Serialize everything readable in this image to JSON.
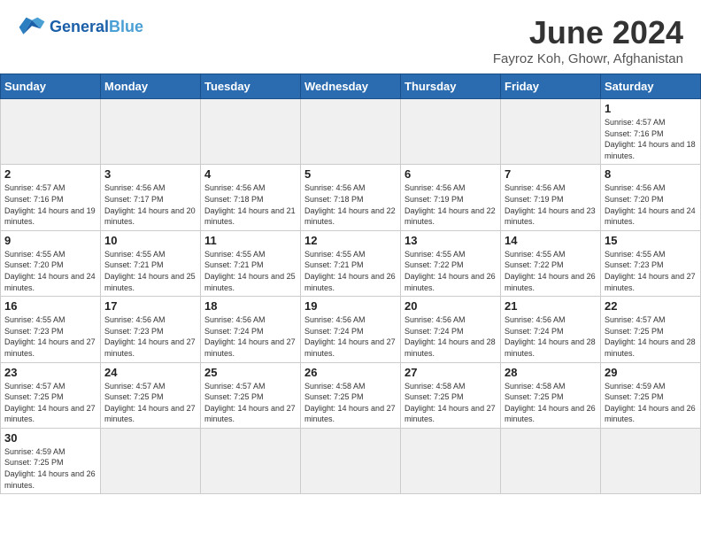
{
  "header": {
    "logo_general": "General",
    "logo_blue": "Blue",
    "title": "June 2024",
    "location": "Fayroz Koh, Ghowr, Afghanistan"
  },
  "weekdays": [
    "Sunday",
    "Monday",
    "Tuesday",
    "Wednesday",
    "Thursday",
    "Friday",
    "Saturday"
  ],
  "days": {
    "d1": {
      "num": "1",
      "sunrise": "4:57 AM",
      "sunset": "7:16 PM",
      "daylight": "14 hours and 18 minutes."
    },
    "d2": {
      "num": "2",
      "sunrise": "4:57 AM",
      "sunset": "7:16 PM",
      "daylight": "14 hours and 19 minutes."
    },
    "d3": {
      "num": "3",
      "sunrise": "4:56 AM",
      "sunset": "7:17 PM",
      "daylight": "14 hours and 20 minutes."
    },
    "d4": {
      "num": "4",
      "sunrise": "4:56 AM",
      "sunset": "7:18 PM",
      "daylight": "14 hours and 21 minutes."
    },
    "d5": {
      "num": "5",
      "sunrise": "4:56 AM",
      "sunset": "7:18 PM",
      "daylight": "14 hours and 22 minutes."
    },
    "d6": {
      "num": "6",
      "sunrise": "4:56 AM",
      "sunset": "7:19 PM",
      "daylight": "14 hours and 22 minutes."
    },
    "d7": {
      "num": "7",
      "sunrise": "4:56 AM",
      "sunset": "7:19 PM",
      "daylight": "14 hours and 23 minutes."
    },
    "d8": {
      "num": "8",
      "sunrise": "4:56 AM",
      "sunset": "7:20 PM",
      "daylight": "14 hours and 24 minutes."
    },
    "d9": {
      "num": "9",
      "sunrise": "4:55 AM",
      "sunset": "7:20 PM",
      "daylight": "14 hours and 24 minutes."
    },
    "d10": {
      "num": "10",
      "sunrise": "4:55 AM",
      "sunset": "7:21 PM",
      "daylight": "14 hours and 25 minutes."
    },
    "d11": {
      "num": "11",
      "sunrise": "4:55 AM",
      "sunset": "7:21 PM",
      "daylight": "14 hours and 25 minutes."
    },
    "d12": {
      "num": "12",
      "sunrise": "4:55 AM",
      "sunset": "7:21 PM",
      "daylight": "14 hours and 26 minutes."
    },
    "d13": {
      "num": "13",
      "sunrise": "4:55 AM",
      "sunset": "7:22 PM",
      "daylight": "14 hours and 26 minutes."
    },
    "d14": {
      "num": "14",
      "sunrise": "4:55 AM",
      "sunset": "7:22 PM",
      "daylight": "14 hours and 26 minutes."
    },
    "d15": {
      "num": "15",
      "sunrise": "4:55 AM",
      "sunset": "7:23 PM",
      "daylight": "14 hours and 27 minutes."
    },
    "d16": {
      "num": "16",
      "sunrise": "4:55 AM",
      "sunset": "7:23 PM",
      "daylight": "14 hours and 27 minutes."
    },
    "d17": {
      "num": "17",
      "sunrise": "4:56 AM",
      "sunset": "7:23 PM",
      "daylight": "14 hours and 27 minutes."
    },
    "d18": {
      "num": "18",
      "sunrise": "4:56 AM",
      "sunset": "7:24 PM",
      "daylight": "14 hours and 27 minutes."
    },
    "d19": {
      "num": "19",
      "sunrise": "4:56 AM",
      "sunset": "7:24 PM",
      "daylight": "14 hours and 27 minutes."
    },
    "d20": {
      "num": "20",
      "sunrise": "4:56 AM",
      "sunset": "7:24 PM",
      "daylight": "14 hours and 28 minutes."
    },
    "d21": {
      "num": "21",
      "sunrise": "4:56 AM",
      "sunset": "7:24 PM",
      "daylight": "14 hours and 28 minutes."
    },
    "d22": {
      "num": "22",
      "sunrise": "4:57 AM",
      "sunset": "7:25 PM",
      "daylight": "14 hours and 28 minutes."
    },
    "d23": {
      "num": "23",
      "sunrise": "4:57 AM",
      "sunset": "7:25 PM",
      "daylight": "14 hours and 27 minutes."
    },
    "d24": {
      "num": "24",
      "sunrise": "4:57 AM",
      "sunset": "7:25 PM",
      "daylight": "14 hours and 27 minutes."
    },
    "d25": {
      "num": "25",
      "sunrise": "4:57 AM",
      "sunset": "7:25 PM",
      "daylight": "14 hours and 27 minutes."
    },
    "d26": {
      "num": "26",
      "sunrise": "4:58 AM",
      "sunset": "7:25 PM",
      "daylight": "14 hours and 27 minutes."
    },
    "d27": {
      "num": "27",
      "sunrise": "4:58 AM",
      "sunset": "7:25 PM",
      "daylight": "14 hours and 27 minutes."
    },
    "d28": {
      "num": "28",
      "sunrise": "4:58 AM",
      "sunset": "7:25 PM",
      "daylight": "14 hours and 26 minutes."
    },
    "d29": {
      "num": "29",
      "sunrise": "4:59 AM",
      "sunset": "7:25 PM",
      "daylight": "14 hours and 26 minutes."
    },
    "d30": {
      "num": "30",
      "sunrise": "4:59 AM",
      "sunset": "7:25 PM",
      "daylight": "14 hours and 26 minutes."
    }
  }
}
